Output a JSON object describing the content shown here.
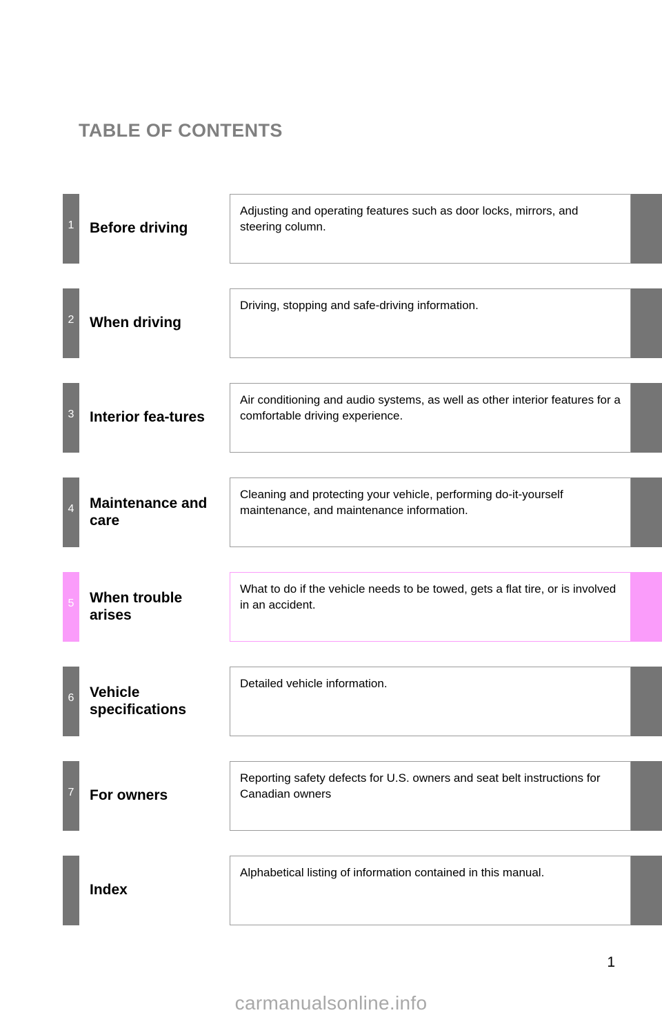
{
  "page": {
    "title": "TABLE OF CONTENTS",
    "page_number": "1",
    "watermark": "carmanualsonline.info",
    "colors": {
      "tab_gray": "#757575",
      "tab_highlight_pink": "#fa9cfa",
      "title_gray": "#808080",
      "box_border": "#9a9a9a",
      "watermark_gray": "#a8a8a8"
    }
  },
  "rows": [
    {
      "number": "1",
      "chapter": "Before driving",
      "description": "Adjusting and operating features such as door locks, mirrors, and steering column.",
      "highlighted": false
    },
    {
      "number": "2",
      "chapter": "When driving",
      "description": "Driving, stopping and safe-driving information.",
      "highlighted": false
    },
    {
      "number": "3",
      "chapter": "Interior fea-tures",
      "description": "Air conditioning and audio systems, as well as other interior features for a comfortable driving experience.",
      "highlighted": false
    },
    {
      "number": "4",
      "chapter": "Maintenance and care",
      "description": "Cleaning and protecting your vehicle, performing do-it-yourself maintenance, and maintenance information.",
      "highlighted": false
    },
    {
      "number": "5",
      "chapter": "When trouble arises",
      "description": "What to do if the vehicle needs to be towed, gets a flat tire, or is involved in an accident.",
      "highlighted": true
    },
    {
      "number": "6",
      "chapter": "Vehicle specifications",
      "description": "Detailed vehicle information.",
      "highlighted": false
    },
    {
      "number": "7",
      "chapter": "For owners",
      "description": "Reporting safety defects for U.S. owners and seat belt instructions for Canadian owners",
      "highlighted": false
    },
    {
      "number": "",
      "chapter": "Index",
      "description": "Alphabetical listing of information contained in this manual.",
      "highlighted": false
    }
  ]
}
